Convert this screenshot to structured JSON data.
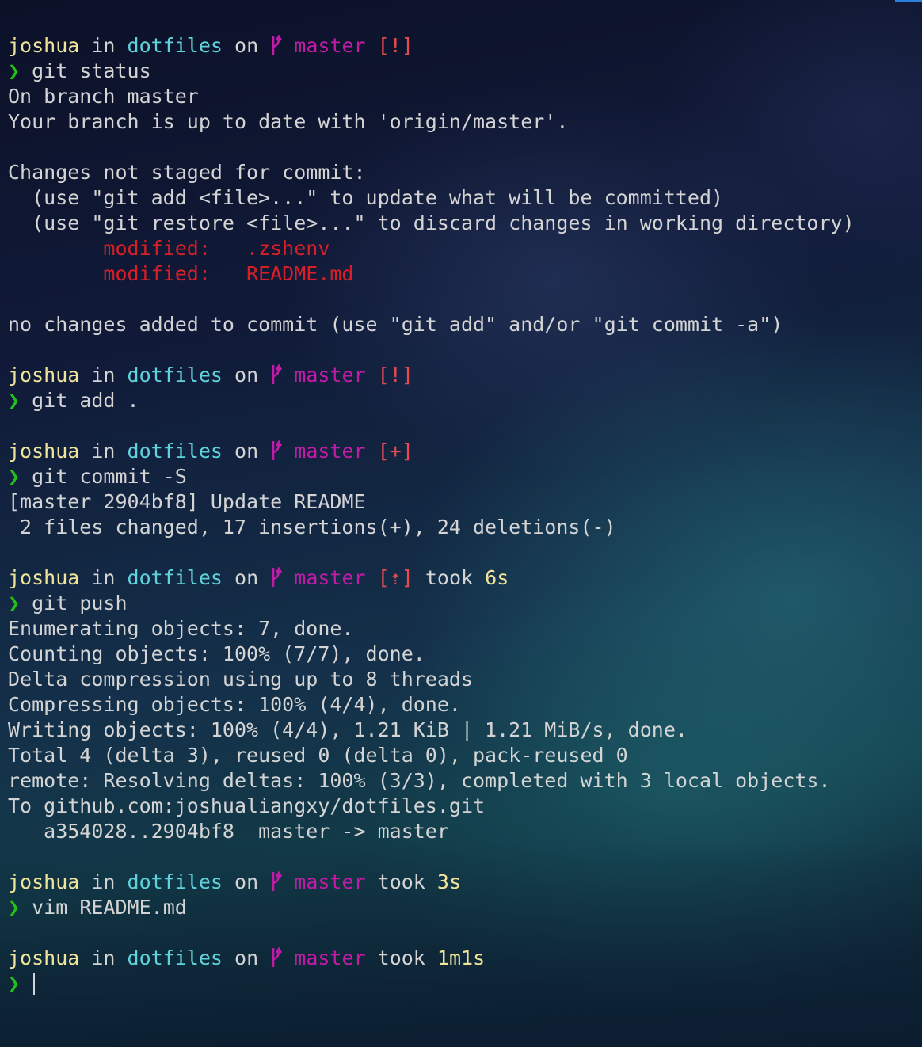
{
  "colors": {
    "user": "#f0e49a",
    "dir": "#5fd3dc",
    "branch": "#c21ba7",
    "status": "#ea4a4f",
    "prompt": "#22c11b",
    "modified": "#d91e28"
  },
  "prompt_symbol": "❯",
  "blocks": [
    {
      "prompt": {
        "user": "joshua",
        "in": "in",
        "dir": "dotfiles",
        "on": "on",
        "branch": "master",
        "status": "[!]",
        "took": "",
        "duration": ""
      },
      "command": "git status",
      "output": [
        "On branch master",
        "Your branch is up to date with 'origin/master'.",
        "",
        "Changes not staged for commit:",
        "  (use \"git add <file>...\" to update what will be committed)",
        "  (use \"git restore <file>...\" to discard changes in working directory)"
      ],
      "modified": [
        {
          "label": "modified:",
          "file": ".zshenv"
        },
        {
          "label": "modified:",
          "file": "README.md"
        }
      ],
      "output_after": [
        "",
        "no changes added to commit (use \"git add\" and/or \"git commit -a\")"
      ]
    },
    {
      "prompt": {
        "user": "joshua",
        "in": "in",
        "dir": "dotfiles",
        "on": "on",
        "branch": "master",
        "status": "[!]",
        "took": "",
        "duration": ""
      },
      "command": "git add ."
    },
    {
      "prompt": {
        "user": "joshua",
        "in": "in",
        "dir": "dotfiles",
        "on": "on",
        "branch": "master",
        "status": "[+]",
        "took": "",
        "duration": ""
      },
      "command": "git commit -S",
      "output": [
        "[master 2904bf8] Update README",
        " 2 files changed, 17 insertions(+), 24 deletions(-)"
      ]
    },
    {
      "prompt": {
        "user": "joshua",
        "in": "in",
        "dir": "dotfiles",
        "on": "on",
        "branch": "master",
        "status": "[⇡]",
        "took": "took",
        "duration": "6s"
      },
      "command": "git push",
      "output": [
        "Enumerating objects: 7, done.",
        "Counting objects: 100% (7/7), done.",
        "Delta compression using up to 8 threads",
        "Compressing objects: 100% (4/4), done.",
        "Writing objects: 100% (4/4), 1.21 KiB | 1.21 MiB/s, done.",
        "Total 4 (delta 3), reused 0 (delta 0), pack-reused 0",
        "remote: Resolving deltas: 100% (3/3), completed with 3 local objects.",
        "To github.com:joshualiangxy/dotfiles.git",
        "   a354028..2904bf8  master -> master"
      ]
    },
    {
      "prompt": {
        "user": "joshua",
        "in": "in",
        "dir": "dotfiles",
        "on": "on",
        "branch": "master",
        "status": "",
        "took": "took",
        "duration": "3s"
      },
      "command": "vim README.md"
    },
    {
      "prompt": {
        "user": "joshua",
        "in": "in",
        "dir": "dotfiles",
        "on": "on",
        "branch": "master",
        "status": "",
        "took": "took",
        "duration": "1m1s"
      },
      "command": ""
    }
  ]
}
